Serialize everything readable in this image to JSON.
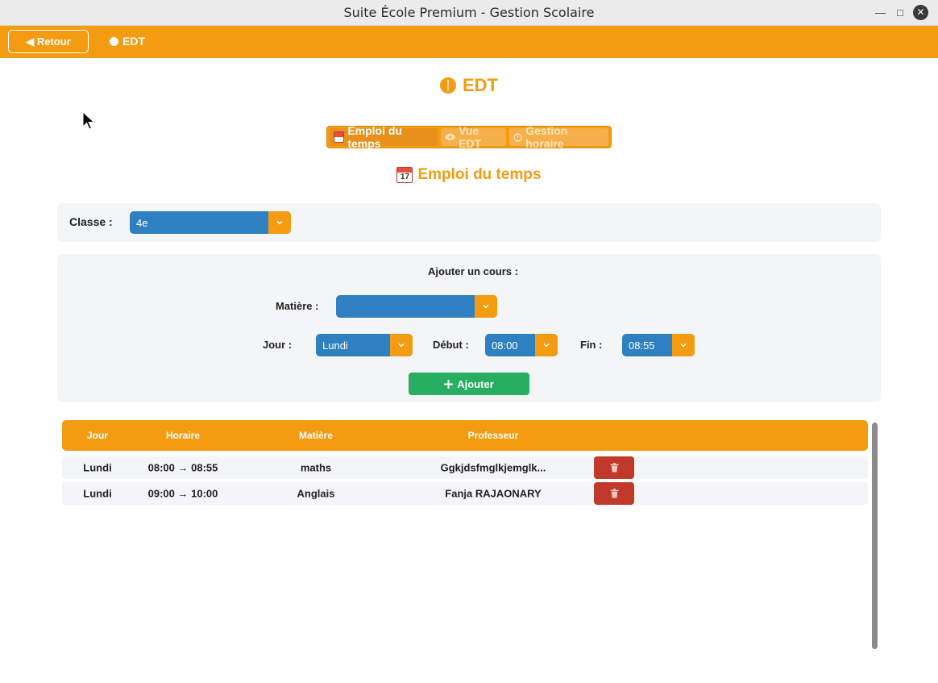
{
  "window": {
    "title": "Suite École Premium - Gestion Scolaire",
    "minimize": "—",
    "maximize": "□",
    "close": "✕"
  },
  "topbar": {
    "back_label": "◀ Retour",
    "title": "EDT"
  },
  "page": {
    "title": "EDT"
  },
  "tabs": [
    {
      "icon": "calendar-icon",
      "label": "Emploi du temps",
      "active": true
    },
    {
      "icon": "eye-icon",
      "label": "Vue EDT",
      "active": false
    },
    {
      "icon": "timer-icon",
      "label": "Gestion horaire",
      "active": false
    }
  ],
  "section": {
    "title": "Emploi du temps",
    "calendar_day": "17"
  },
  "class_filter": {
    "label": "Classe :",
    "value": "4e"
  },
  "add_form": {
    "title": "Ajouter un cours :",
    "subject_label": "Matière :",
    "subject_value": "",
    "day_label": "Jour :",
    "day_value": "Lundi",
    "start_label": "Début :",
    "start_value": "08:00",
    "end_label": "Fin :",
    "end_value": "08:55",
    "add_button": "Ajouter"
  },
  "table": {
    "headers": {
      "day": "Jour",
      "time": "Horaire",
      "subject": "Matière",
      "teacher": "Professeur"
    },
    "rows": [
      {
        "day": "Lundi",
        "time": "08:00 → 08:55",
        "subject": "maths",
        "teacher": "Ggkjdsfmglkjemglk..."
      },
      {
        "day": "Lundi",
        "time": "09:00 → 10:00",
        "subject": "Anglais",
        "teacher": "Fanja RAJAONARY"
      }
    ]
  },
  "colors": {
    "accent": "#f39c12",
    "select_blue": "#2e80c0",
    "success": "#27ae60",
    "danger": "#c0392b",
    "panel": "#f4f5f7"
  }
}
